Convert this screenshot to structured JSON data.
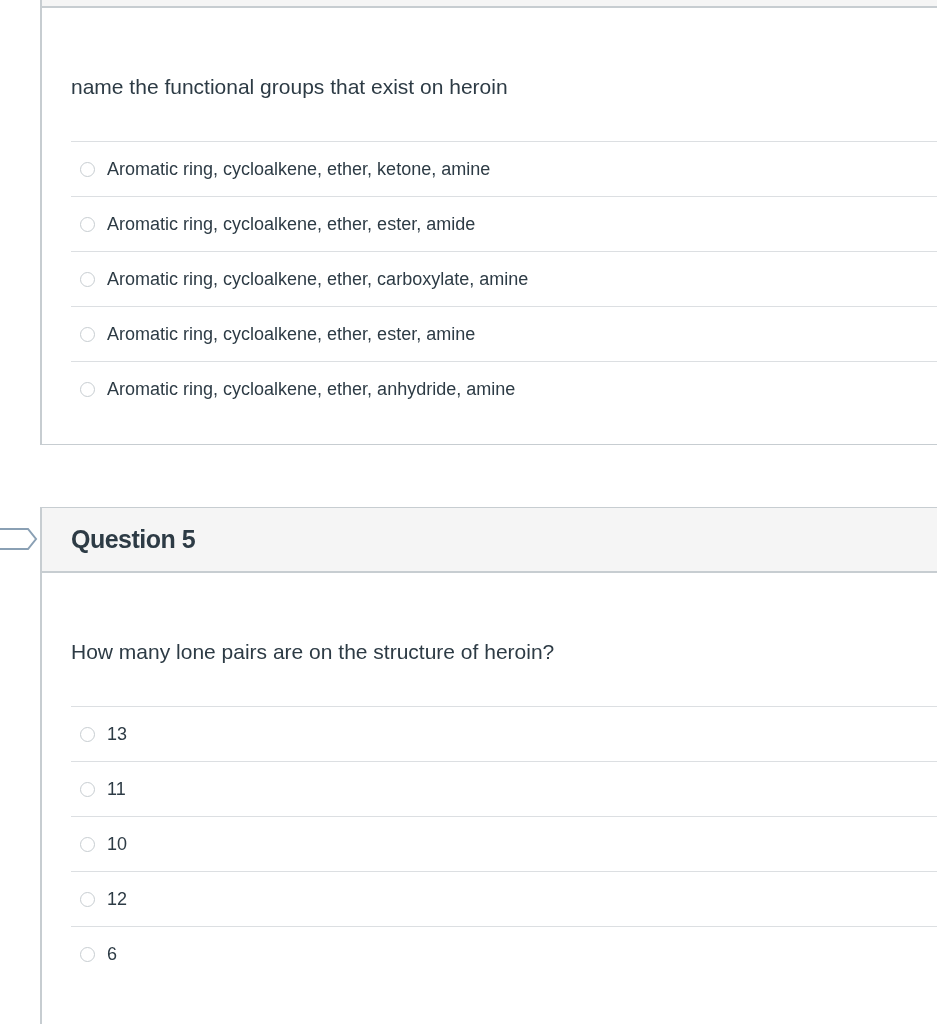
{
  "questions": [
    {
      "text": "name the functional groups that exist on heroin",
      "answers": [
        {
          "label": "Aromatic ring, cycloalkene, ether, ketone, amine",
          "selected": false
        },
        {
          "label": "Aromatic ring, cycloalkene, ether, ester, amide",
          "selected": false
        },
        {
          "label": "Aromatic ring, cycloalkene, ether, carboxylate, amine",
          "selected": false
        },
        {
          "label": "Aromatic ring, cycloalkene, ether, ester, amine",
          "selected": false
        },
        {
          "label": "Aromatic ring, cycloalkene, ether, anhydride, amine",
          "selected": false
        }
      ]
    },
    {
      "title": "Question 5",
      "text": "How many lone pairs are on the structure of heroin?",
      "answers": [
        {
          "label": "13",
          "selected": false
        },
        {
          "label": "11",
          "selected": false
        },
        {
          "label": "10",
          "selected": false
        },
        {
          "label": "12",
          "selected": false
        },
        {
          "label": "6",
          "selected": false
        }
      ]
    }
  ]
}
